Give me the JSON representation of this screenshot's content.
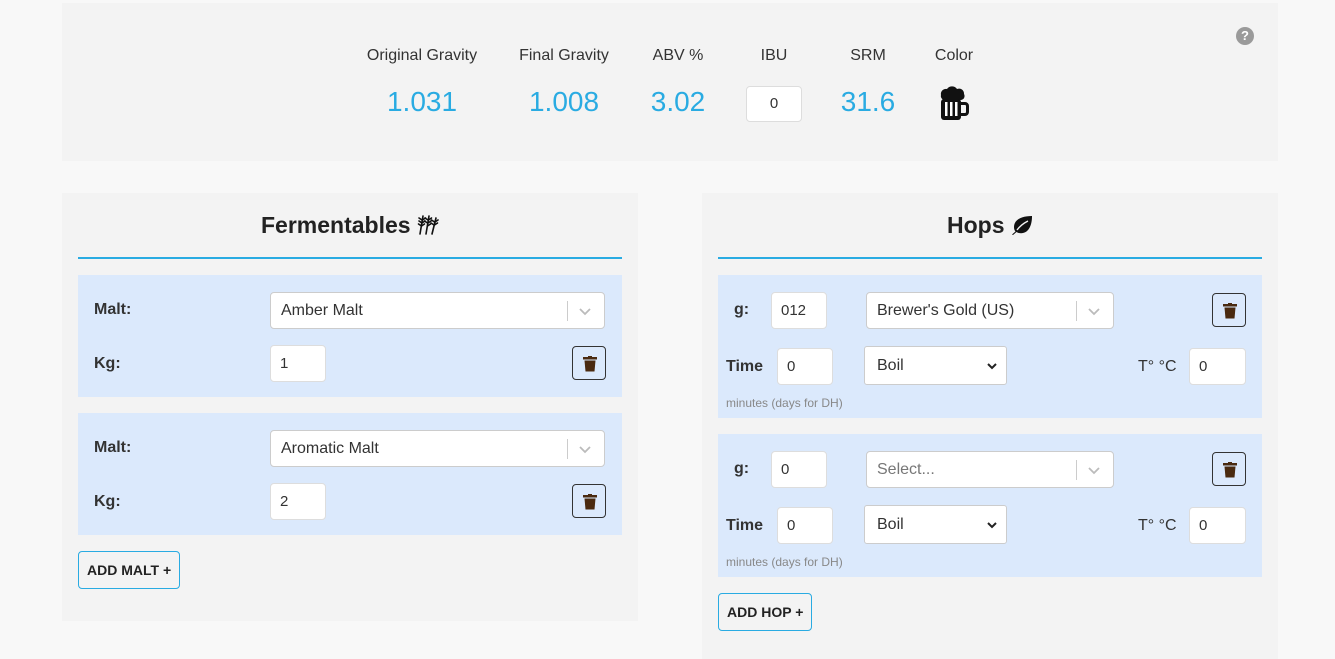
{
  "stats": {
    "og_label": "Original Gravity",
    "og_value": "1.031",
    "fg_label": "Final Gravity",
    "fg_value": "1.008",
    "abv_label": "ABV %",
    "abv_value": "3.02",
    "ibu_label": "IBU",
    "ibu_value": "0",
    "srm_label": "SRM",
    "srm_value": "31.6",
    "color_label": "Color",
    "color_icon": "beer-mug-icon",
    "help_icon": "question-circle-icon",
    "help_glyph": "?"
  },
  "fermentables": {
    "title": "Fermentables",
    "title_icon": "wheat-icon",
    "malt_label": "Malt:",
    "kg_label": "Kg:",
    "items": [
      {
        "malt": "Amber Malt",
        "kg": "1"
      },
      {
        "malt": "Aromatic Malt",
        "kg": "2"
      }
    ],
    "add_label": "ADD MALT +"
  },
  "hops": {
    "title": "Hops",
    "title_icon": "leaf-icon",
    "g_label": "g:",
    "time_label": "Time",
    "temp_label": "T° °C",
    "hint": "minutes (days for DH)",
    "items": [
      {
        "g": "012",
        "hop": "Brewer's Gold (US)",
        "hop_placeholder": false,
        "time": "0",
        "use": "Boil",
        "temp": "0"
      },
      {
        "g": "0",
        "hop": "Select...",
        "hop_placeholder": true,
        "time": "0",
        "use": "Boil",
        "temp": "0"
      }
    ],
    "add_label": "ADD HOP +"
  },
  "colors": {
    "accent": "#29abe2",
    "row_bg": "#dbe9fc",
    "panel_bg": "#f3f3f3",
    "trash": "#4a2a10"
  }
}
